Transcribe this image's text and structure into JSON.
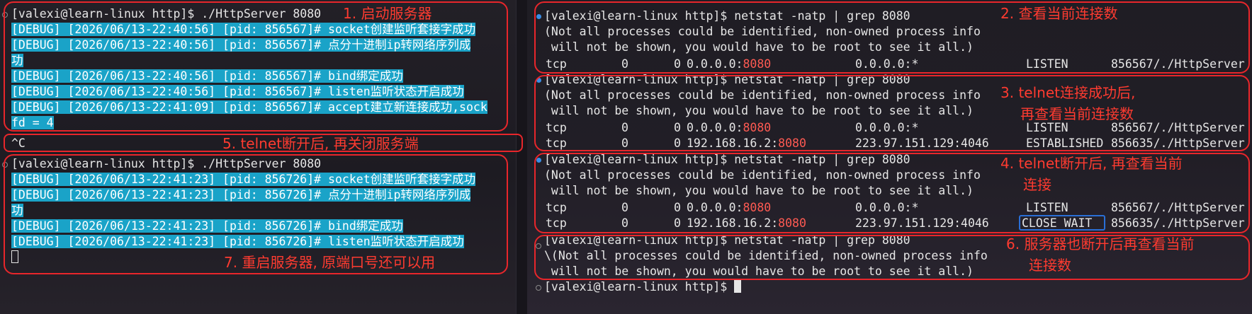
{
  "left_terminal": {
    "cmd1": "[valexi@learn-linux http]$ ./HttpServer 8080",
    "logs1": [
      "[DEBUG] [2026/06/13-22:40:56] [pid: 856567]# socket创建监听套接字成功",
      "[DEBUG] [2026/06/13-22:40:56] [pid: 856567]# 点分十进制ip转网络序列成",
      "功",
      "[DEBUG] [2026/06/13-22:40:56] [pid: 856567]# bind绑定成功",
      "[DEBUG] [2026/06/13-22:40:56] [pid: 856567]# listen监听状态开启成功",
      "[DEBUG] [2026/06/13-22:41:09] [pid: 856567]# accept建立新连接成功,sock",
      "fd = 4"
    ],
    "interrupt": "^C",
    "cmd2": "[valexi@learn-linux http]$ ./HttpServer 8080",
    "logs2": [
      "[DEBUG] [2026/06/13-22:41:23] [pid: 856726]# socket创建监听套接字成功",
      "[DEBUG] [2026/06/13-22:41:23] [pid: 856726]# 点分十进制ip转网络序列成",
      "功",
      "[DEBUG] [2026/06/13-22:41:23] [pid: 856726]# bind绑定成功",
      "[DEBUG] [2026/06/13-22:41:23] [pid: 856726]# listen监听状态开启成功"
    ]
  },
  "right_terminal": {
    "cmd": "[valexi@learn-linux http]$ netstat -natp | grep 8080",
    "warn1": "(Not all processes could be identified, non-owned process info",
    "warn1_alt": "\\(Not all processes could be identified, non-owned process info",
    "warn2": " will not be shown, you would have to be root to see it all.)",
    "listen_row": {
      "proto": "tcp",
      "recvq": "0",
      "sendq": "0",
      "local_ip": "0.0.0.0:",
      "port": "8080",
      "foreign": "0.0.0.0:*",
      "state": "LISTEN",
      "pid": "856567/./HttpServer"
    },
    "est_row": {
      "proto": "tcp",
      "recvq": "0",
      "sendq": "0",
      "local_ip": "192.168.16.2:",
      "port": "8080",
      "foreign": "223.97.151.129:4046",
      "state": "ESTABLISHED",
      "pid": "856635/./HttpServer"
    },
    "cw_row": {
      "proto": "tcp",
      "recvq": "0",
      "sendq": "0",
      "local_ip": "192.168.16.2:",
      "port": "8080",
      "foreign": "223.97.151.129:4046",
      "state": "CLOSE_WAIT",
      "pid": "856635/./HttpServer"
    },
    "prompt": "[valexi@learn-linux http]$ "
  },
  "annotations": {
    "n1": "1. 启动服务器",
    "n2": "2. 查看当前连接数",
    "n3a": "3. telnet连接成功后,",
    "n3b": "再查看当前连接数",
    "n4a": "4. telnet断开后, 再查看当前",
    "n4b": "连接",
    "n5": "5. telnet断开后, 再关闭服务端",
    "n6a": "6. 服务器也断开后再查看当前",
    "n6b": "连接数",
    "n7": "7. 重启服务器, 原端口号还可以用"
  },
  "colors": {
    "highlight": "#1aa3c8",
    "annotation": "#e8262b",
    "port": "#ff5a52",
    "close_wait_box": "#2a6fd6"
  }
}
